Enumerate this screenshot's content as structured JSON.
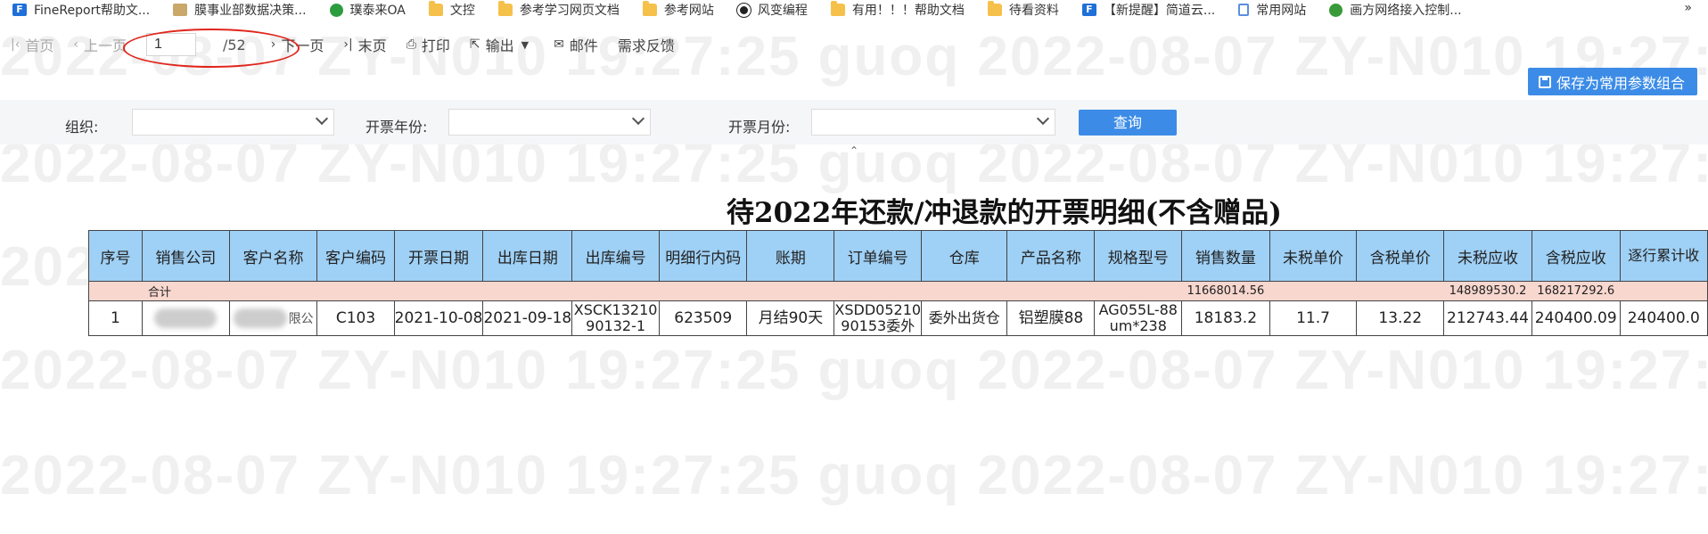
{
  "bookmarks": [
    {
      "label": "FineReport帮助文...",
      "icon": "finereport-icon"
    },
    {
      "label": "膜事业部数据决策...",
      "icon": "chart-icon"
    },
    {
      "label": "璞泰来OA",
      "icon": "gear-icon"
    },
    {
      "label": "文控",
      "icon": "folder-icon"
    },
    {
      "label": "参考学习网页文档",
      "icon": "folder-icon"
    },
    {
      "label": "参考网站",
      "icon": "folder-icon"
    },
    {
      "label": "风变编程",
      "icon": "panda-icon"
    },
    {
      "label": "有用！！！帮助文档",
      "icon": "folder-icon"
    },
    {
      "label": "待看资料",
      "icon": "folder-icon"
    },
    {
      "label": "【新提醒】简道云...",
      "icon": "finereport-icon"
    },
    {
      "label": "常用网站",
      "icon": "document-icon"
    },
    {
      "label": "画方网络接入控制...",
      "icon": "network-icon"
    }
  ],
  "bookmarks_more": "»",
  "toolbar": {
    "first": "首页",
    "prev": "上一页",
    "page_value": "1",
    "page_total": "/52",
    "next": "下一页",
    "last": "末页",
    "print": "打印",
    "export": "输出",
    "email": "邮件",
    "feedback": "需求反馈"
  },
  "save_params_label": "保存为常用参数组合",
  "filters": {
    "org_label": "组织:",
    "year_label": "开票年份:",
    "month_label": "开票月份:",
    "query_label": "查询"
  },
  "watermark": "2022-08-07   ZY-N010   19:27:25   guoq   2022-08-07   ZY-N010   19:27:25",
  "report": {
    "title": "待2022年还款/冲退款的开票明细(不含赠品)",
    "headers": [
      "序号",
      "销售公司",
      "客户名称",
      "客户编码",
      "开票日期",
      "出库日期",
      "出库编号",
      "明细行内码",
      "账期",
      "订单编号",
      "仓库",
      "产品名称",
      "规格型号",
      "销售数量",
      "未税单价",
      "含税单价",
      "未税应收",
      "含税应收",
      "逐行累计收"
    ],
    "summary": {
      "label": "合计",
      "qty": "11668014.56",
      "untaxed": "148989530.2",
      "taxed": "168217292.6"
    },
    "row": {
      "no": "1",
      "customer_tail": "限公",
      "customer_code": "C103",
      "invoice_date": "2021-10-08",
      "out_date": "2021-09-18",
      "out_no": "XSCK1321090132-1",
      "line_code": "623509",
      "term": "月结90天",
      "order_no": "XSDD0521090153委外",
      "warehouse": "委外出货仓",
      "product": "铝塑膜88",
      "spec": "AG055L-88um*238",
      "qty": "18183.2",
      "untaxed_price": "11.7",
      "taxed_price": "13.22",
      "untaxed_recv": "212743.44",
      "taxed_recv": "240400.09",
      "cumulative": "240400.0"
    }
  }
}
